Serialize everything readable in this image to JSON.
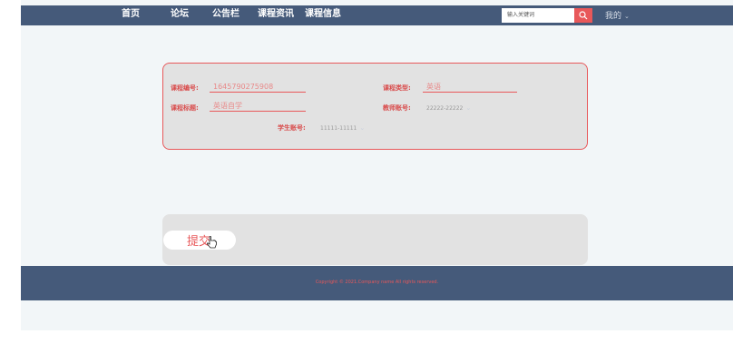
{
  "nav": {
    "items": [
      "首页",
      "论坛",
      "公告栏",
      "课程资讯",
      "课程信息"
    ],
    "search_placeholder": "输入关键词",
    "my_label": "我的"
  },
  "form": {
    "course_no_label": "课程编号:",
    "course_no_value": "1645790275908",
    "course_type_label": "课程类型:",
    "course_type_value": "英语",
    "course_title_label": "课程标题:",
    "course_title_value": "英语自学",
    "teacher_label": "教师账号:",
    "teacher_value": "22222-22222",
    "student_label": "学生账号:",
    "student_value": "11111-11111"
  },
  "submit_label": "提交",
  "footer": {
    "copyright": "Copyright © 2021.Company name All rights reserved."
  },
  "colors": {
    "navbar": "#455a7a",
    "accent": "#e8585a",
    "card": "#e2e2e2",
    "page": "#f2f6f8"
  }
}
